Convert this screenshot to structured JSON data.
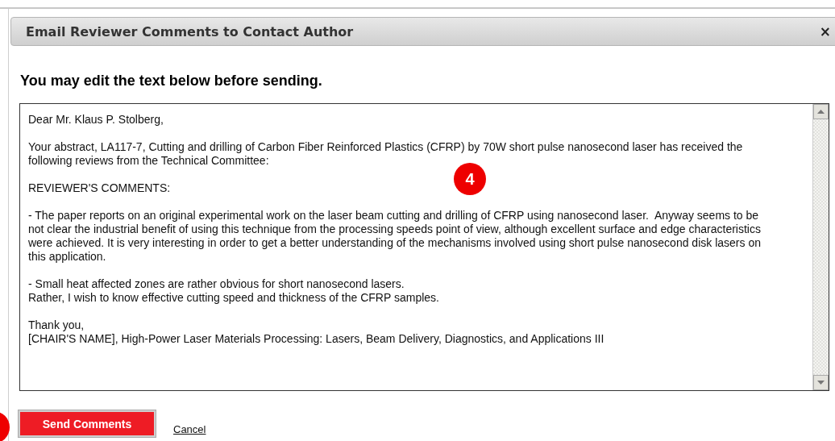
{
  "dialog": {
    "title": "Email Reviewer Comments to Contact Author",
    "close": "×"
  },
  "instruction": "You may edit the text below before sending.",
  "message": {
    "paragraphs": [
      [
        "Dear Mr. Klaus P. Stolberg,"
      ],
      [
        "Your abstract, LA117-7, Cutting and drilling of Carbon Fiber Reinforced Plastics (CFRP) by 70W short pulse nanosecond laser has received the",
        "following reviews from the Technical Committee:"
      ],
      [
        "REVIEWER'S COMMENTS:"
      ],
      [
        "- The paper reports on an original experimental work on the laser beam cutting and drilling of CFRP using nanosecond laser.  Anyway seems to be",
        "not clear the industrial benefit of using this technique from the processing speeds point of view, although excellent surface and edge characteristics",
        "were achieved. It is very interesting in order to get a better understanding of the mechanisms involved using short pulse nanosecond disk lasers on",
        "this application."
      ],
      [
        "- Small heat affected zones are rather obvious for short nanosecond lasers.",
        "Rather, I wish to know effective cutting speed and thickness of the CFRP samples."
      ],
      [
        "Thank you,",
        "[CHAIR'S NAME], High-Power Laser Materials Processing: Lasers, Beam Delivery, Diagnostics, and Applications III"
      ]
    ]
  },
  "callouts": [
    {
      "kind": "marker",
      "label": "4"
    },
    {
      "kind": "marker"
    }
  ],
  "buttons": {
    "send": "Send Comments",
    "cancel": "Cancel"
  }
}
